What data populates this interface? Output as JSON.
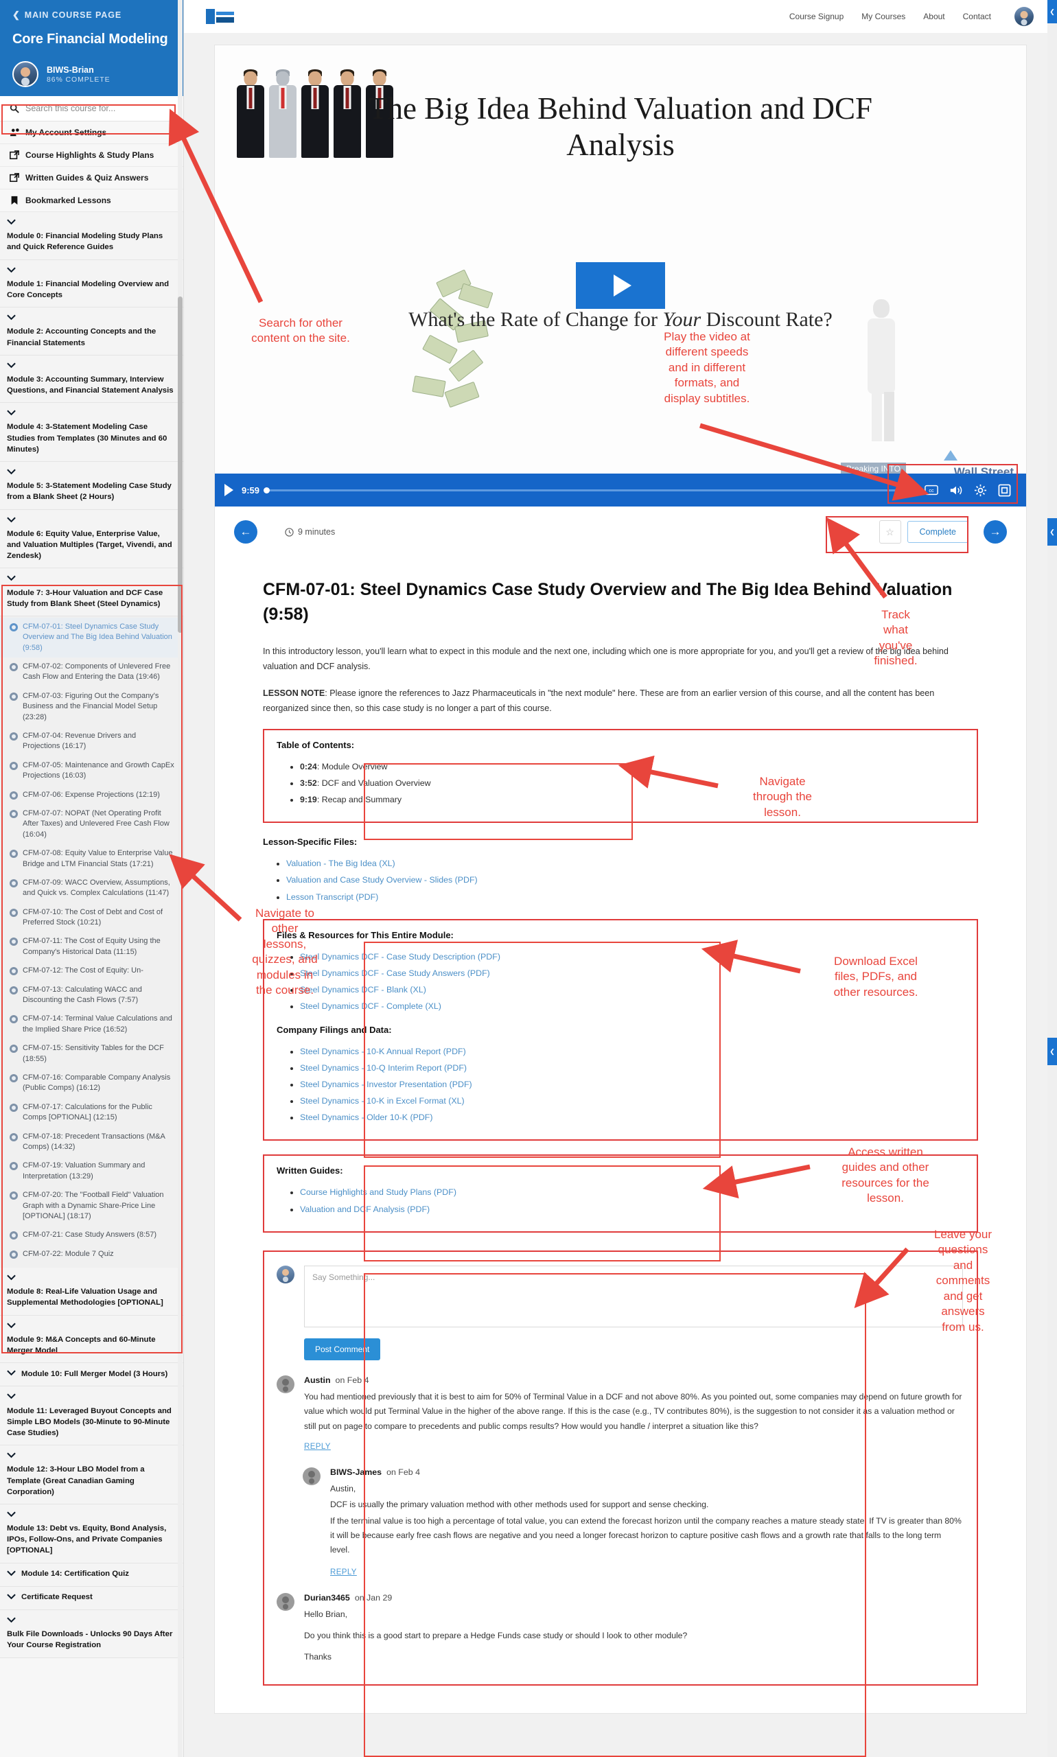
{
  "sidebar": {
    "back_label": "MAIN COURSE PAGE",
    "course_title": "Core Financial Modeling",
    "user_name": "BIWS-Brian",
    "progress": "86% COMPLETE",
    "search_placeholder": "Search this course for...",
    "links": [
      {
        "label": "My Account Settings",
        "icon": "user-gear-icon"
      },
      {
        "label": "Course Highlights & Study Plans",
        "icon": "external-link-icon"
      },
      {
        "label": "Written Guides & Quiz Answers",
        "icon": "external-link-icon"
      },
      {
        "label": "Bookmarked Lessons",
        "icon": "bookmark-icon"
      }
    ],
    "modules": [
      {
        "label": "Module 0: Financial Modeling Study Plans and Quick Reference Guides"
      },
      {
        "label": "Module 1: Financial Modeling Overview and Core Concepts"
      },
      {
        "label": "Module 2: Accounting Concepts and the Financial Statements"
      },
      {
        "label": "Module 3: Accounting Summary, Interview Questions, and Financial Statement Analysis"
      },
      {
        "label": "Module 4: 3-Statement Modeling Case Studies from Templates (30 Minutes and 60 Minutes)"
      },
      {
        "label": "Module 5: 3-Statement Modeling Case Study from a Blank Sheet (2 Hours)"
      },
      {
        "label": "Module 6: Equity Value, Enterprise Value, and Valuation Multiples (Target, Vivendi, and Zendesk)"
      }
    ],
    "active_module": "Module 7: 3-Hour Valuation and DCF Case Study from Blank Sheet (Steel Dynamics)",
    "lessons": [
      "CFM-07-01: Steel Dynamics Case Study Overview and The Big Idea Behind Valuation (9:58)",
      "CFM-07-02: Components of Unlevered Free Cash Flow and Entering the Data (19:46)",
      "CFM-07-03: Figuring Out the Company's Business and the Financial Model Setup (23:28)",
      "CFM-07-04: Revenue Drivers and Projections (16:17)",
      "CFM-07-05: Maintenance and Growth CapEx Projections (16:03)",
      "CFM-07-06: Expense Projections (12:19)",
      "CFM-07-07: NOPAT (Net Operating Profit After Taxes) and Unlevered Free Cash Flow (16:04)",
      "CFM-07-08: Equity Value to Enterprise Value Bridge and LTM Financial Stats (17:21)",
      "CFM-07-09: WACC Overview, Assumptions, and Quick vs. Complex Calculations (11:47)",
      "CFM-07-10: The Cost of Debt and Cost of Preferred Stock (10:21)",
      "CFM-07-11: The Cost of Equity Using the Company's Historical Data (11:15)",
      "CFM-07-12: The Cost of Equity: Un-",
      "CFM-07-13: Calculating WACC and Discounting the Cash Flows (7:57)",
      "CFM-07-14: Terminal Value Calculations and the Implied Share Price (16:52)",
      "CFM-07-15: Sensitivity Tables for the DCF (18:55)",
      "CFM-07-16: Comparable Company Analysis (Public Comps) (16:12)",
      "CFM-07-17: Calculations for the Public Comps [OPTIONAL] (12:15)",
      "CFM-07-18: Precedent Transactions (M&A Comps) (14:32)",
      "CFM-07-19: Valuation Summary and Interpretation (13:29)",
      "CFM-07-20: The \"Football Field\" Valuation Graph with a Dynamic Share-Price Line [OPTIONAL] (18:17)",
      "CFM-07-21: Case Study Answers (8:57)",
      "CFM-07-22: Module 7 Quiz"
    ],
    "modules_after": [
      {
        "label": "Module 8: Real-Life Valuation Usage and Supplemental Methodologies [OPTIONAL]"
      },
      {
        "label": "Module 9: M&A Concepts and 60-Minute Merger Model"
      },
      {
        "label": "Module 10: Full Merger Model (3 Hours)",
        "inline": true
      },
      {
        "label": "Module 11: Leveraged Buyout Concepts and Simple LBO Models (30-Minute to 90-Minute Case Studies)"
      },
      {
        "label": "Module 12: 3-Hour LBO Model from a Template (Great Canadian Gaming Corporation)"
      },
      {
        "label": "Module 13: Debt vs. Equity, Bond Analysis, IPOs, Follow-Ons, and Private Companies [OPTIONAL]"
      },
      {
        "label": "Module 14: Certification Quiz",
        "inline": true
      },
      {
        "label": "Certificate Request",
        "inline": true
      },
      {
        "label": "Bulk File Downloads - Unlocks 90 Days After Your Course Registration"
      }
    ]
  },
  "topnav": {
    "items": [
      "Course Signup",
      "My Courses",
      "About",
      "Contact"
    ],
    "logo_name": "breaking-into-wall-street-logo"
  },
  "video": {
    "title": "The Big Idea Behind Valuation and DCF Analysis",
    "subtitle_pre": "What's the Rate of Change for ",
    "subtitle_em": "Your",
    "subtitle_post": " Discount Rate?",
    "time": "9:59",
    "breaking_text": "Breaking INTO",
    "wallstreet_text": "Wall Street",
    "controls": [
      "cc-icon",
      "volume-icon",
      "settings-icon",
      "fullscreen-icon"
    ]
  },
  "navrow": {
    "prev_label": "←",
    "next_label": "→",
    "minutes": "9 minutes",
    "star_label": "☆",
    "complete_label": "Complete"
  },
  "lesson": {
    "title": "CFM-07-01: Steel Dynamics Case Study Overview and The Big Idea Behind Valuation (9:58)",
    "intro": "In this introductory lesson, you'll learn what to expect in this module and the next one, including which one is more appropriate for you, and you'll get a review of the big idea behind valuation and DCF analysis.",
    "note_label": "LESSON NOTE",
    "note_text": ": Please ignore the references to Jazz Pharmaceuticals in \"the next module\" here. These are from an earlier version of this course, and all the content has been reorganized since then, so this case study is no longer a part of this course.",
    "toc_heading": "Table of Contents:",
    "toc": [
      {
        "time": "0:24",
        "label": ": Module Overview"
      },
      {
        "time": "3:52",
        "label": ": DCF and Valuation Overview"
      },
      {
        "time": "9:19",
        "label": ": Recap and Summary"
      }
    ],
    "lesson_files_heading": "Lesson-Specific Files:",
    "lesson_files": [
      "Valuation - The Big Idea (XL)",
      "Valuation and Case Study Overview - Slides (PDF)",
      "Lesson Transcript (PDF)"
    ],
    "module_files_heading": "Files & Resources for This Entire Module:",
    "module_files": [
      "Steel Dynamics DCF - Case Study Description (PDF)",
      "Steel Dynamics DCF - Case Study Answers (PDF)",
      "Steel Dynamics DCF - Blank (XL)",
      "Steel Dynamics DCF - Complete (XL)"
    ],
    "filings_heading": "Company Filings and Data:",
    "filings": [
      "Steel Dynamics - 10-K Annual Report (PDF)",
      "Steel Dynamics - 10-Q Interim Report (PDF)",
      "Steel Dynamics - Investor Presentation (PDF)",
      "Steel Dynamics - 10-K in Excel Format (XL)",
      "Steel Dynamics - Older 10-K (PDF)"
    ],
    "guides_heading": "Written Guides:",
    "guides": [
      "Course Highlights and Study Plans (PDF)",
      "Valuation and DCF Analysis (PDF)"
    ]
  },
  "comments": {
    "placeholder": "Say Something...",
    "post_label": "Post Comment",
    "reply_label": "REPLY",
    "items": [
      {
        "author": "Austin",
        "date": "on Feb 4",
        "body": "You had mentioned previously that it is best to aim for 50% of Terminal Value in a DCF and not above 80%. As you pointed out, some companies may depend on future growth for value which would put Terminal Value in the higher of the above range. If this is the case (e.g., TV contributes 80%), is the suggestion to not consider it as a valuation method or still put on page to compare to precedents and public comps results? How would you handle / interpret a situation like this?"
      },
      {
        "author": "BIWS-James",
        "date": "on Feb 4",
        "nested": true,
        "body_lines": [
          "Austin,",
          "DCF is usually the primary valuation method with other methods used for support and sense checking.",
          "If the terminal value is too high a percentage of total value, you can extend the forecast horizon until the company reaches a mature steady state. If TV is greater than 80% it will be because early free cash flows are negative and you need a longer forecast horizon to capture positive cash flows and a growth rate that falls to the long term level."
        ]
      },
      {
        "author": "Durian3465",
        "date": "on Jan 29",
        "body_lines": [
          "Hello Brian,",
          "Do you think this is a good start to prepare a Hedge Funds case study or should I look to other module?",
          "Thanks"
        ]
      }
    ]
  },
  "annotations": [
    {
      "id": "a1",
      "text": "Search for other\ncontent on the site."
    },
    {
      "id": "a2",
      "text": "Play the video at\ndifferent speeds\nand in different\nformats, and\ndisplay subtitles."
    },
    {
      "id": "a3",
      "text": "Track\nwhat\nyou've\nfinished."
    },
    {
      "id": "a4",
      "text": "Navigate\nthrough the\nlesson."
    },
    {
      "id": "a5",
      "text": "Navigate to\nother\nlessons,\nquizzes, and\nmodules in\nthe course."
    },
    {
      "id": "a6",
      "text": "Download Excel\nfiles, PDFs, and\nother resources."
    },
    {
      "id": "a7",
      "text": "Access written\nguides and other\nresources for the\nlesson."
    },
    {
      "id": "a8",
      "text": "Leave your\nquestions\nand\ncomments\nand get\nanswers\nfrom us."
    }
  ]
}
